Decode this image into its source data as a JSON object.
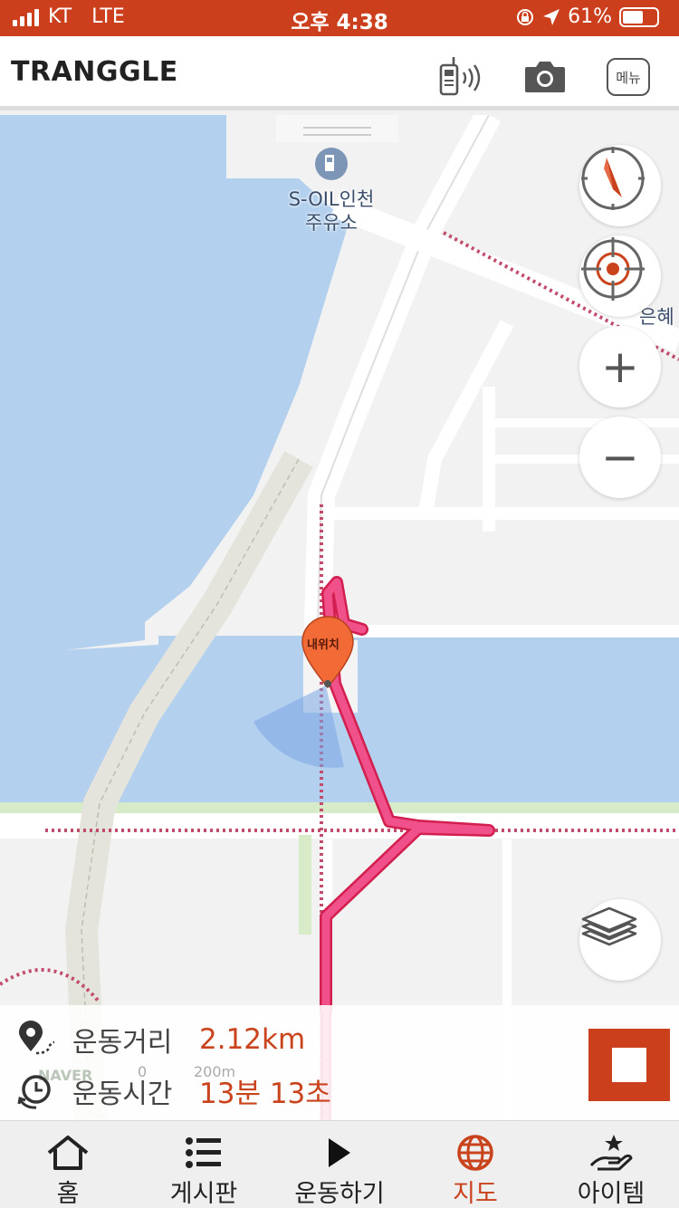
{
  "status_bar": {
    "carrier": "KT",
    "network": "LTE",
    "time": "오후 4:38",
    "battery_percent": "61%",
    "battery_level": 0.61
  },
  "header": {
    "logo": "TRANGGLE",
    "menu_label": "메뉴",
    "icons": [
      "walkie-talkie-icon",
      "camera-icon"
    ]
  },
  "map": {
    "labels": {
      "station_line1": "S-OIL인천",
      "station_line2": "주유소",
      "place_partial": "은혜"
    },
    "pin_label": "내위치",
    "controls": {
      "zoom_in": "+",
      "zoom_out": "−"
    },
    "scale": {
      "zero": "0",
      "distance": "200m"
    },
    "attribution": "NAVER"
  },
  "stats": {
    "distance_label": "운동거리",
    "distance_value": "2.12km",
    "time_label": "운동시간",
    "time_value": "13분 13초"
  },
  "nav": {
    "items": [
      {
        "label": "홈",
        "icon": "home-icon"
      },
      {
        "label": "게시판",
        "icon": "list-icon"
      },
      {
        "label": "운동하기",
        "icon": "play-icon"
      },
      {
        "label": "지도",
        "icon": "globe-icon"
      },
      {
        "label": "아이템",
        "icon": "item-hand-icon"
      }
    ],
    "active_index": 3
  },
  "colors": {
    "brand": "#cc3f1c",
    "track": "#f0518a",
    "water": "#b3d0ee",
    "route_dotted": "#c24c6b"
  }
}
